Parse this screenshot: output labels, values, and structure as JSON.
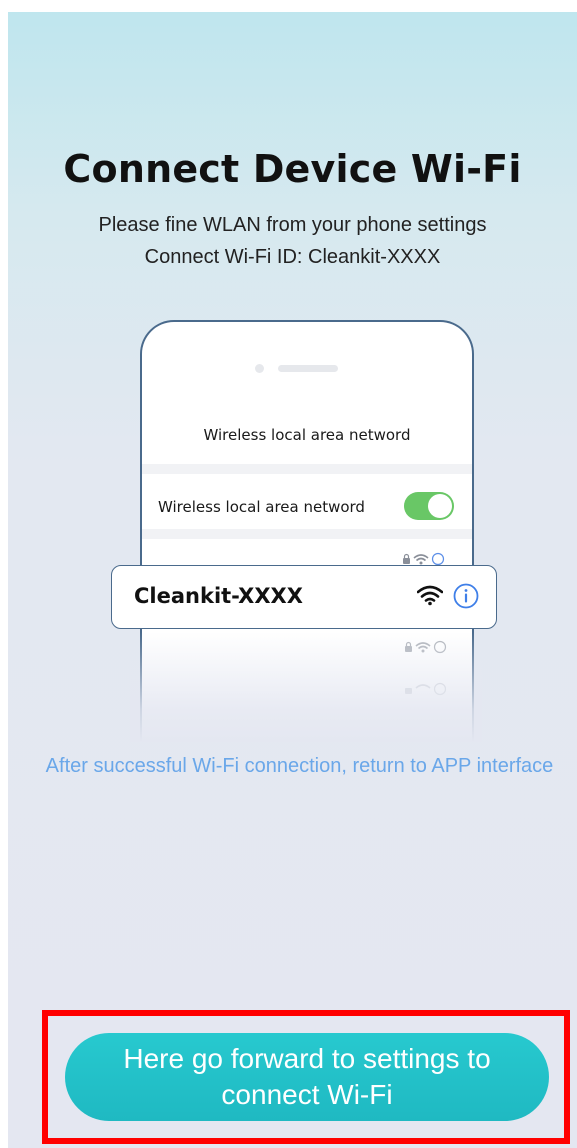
{
  "page": {
    "title": "Connect Device Wi-Fi",
    "subtitle_line1": "Please fine WLAN from your phone settings",
    "subtitle_line2": "Connect Wi-Fi ID: Cleankit-XXXX",
    "after_note": "After successful Wi-Fi connection, return to APP interface"
  },
  "illustration": {
    "header": "Wireless local area netword",
    "wlan_row_label": "Wireless local area netword",
    "wlan_toggle_on": true,
    "network_name": "Cleankit-XXXX",
    "network_icons": [
      "wifi-icon",
      "info-icon"
    ],
    "row_icons": "🔒◠ ⓘ"
  },
  "actions": {
    "settings_button": "Here go forward to settings to connect Wi-Fi"
  },
  "colors": {
    "accent": "#1fb9c2",
    "note_text": "#6aa7e9",
    "toggle_on": "#69c766",
    "highlight": "#ff0000"
  }
}
